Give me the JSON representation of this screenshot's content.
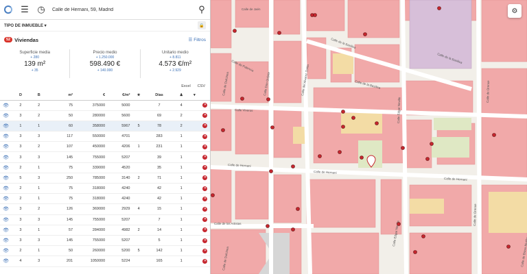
{
  "search": {
    "value": "Calle de Hernani, 59, Madrid"
  },
  "filter": {
    "property_type_label": "TIPO DE INMUEBLE"
  },
  "summary": {
    "count": "52",
    "label": "Viviendas",
    "filters_label": "Filtros"
  },
  "stats": [
    {
      "label": "Superficie media",
      "up": "+ 280",
      "value": "139 m²",
      "down": "+ 35"
    },
    {
      "label": "Precio medio",
      "up": "+ 1.250.000",
      "value": "598.490 €",
      "down": "+ 140.000"
    },
    {
      "label": "Unitario medio",
      "up": "+ 8.811",
      "value": "4.573 €/m²",
      "down": "+ 2.929"
    }
  ],
  "export": {
    "excel": "Excel",
    "csv": "CSV"
  },
  "table": {
    "headers": [
      "D",
      "B",
      "m²",
      "€",
      "€/m²",
      "Días"
    ],
    "rows": [
      [
        "2",
        "2",
        "75",
        "375000",
        "5000",
        "",
        "7",
        "4"
      ],
      [
        "3",
        "2",
        "50",
        "280000",
        "5600",
        "",
        "69",
        "2"
      ],
      [
        "1",
        "1",
        "60",
        "358000",
        "5967",
        "5",
        "78",
        "2"
      ],
      [
        "3",
        "3",
        "117",
        "550000",
        "4701",
        "",
        "283",
        "1"
      ],
      [
        "3",
        "2",
        "107",
        "450000",
        "4206",
        "1",
        "231",
        "1"
      ],
      [
        "3",
        "3",
        "145",
        "755000",
        "5207",
        "",
        "39",
        "1"
      ],
      [
        "2",
        "1",
        "75",
        "339000",
        "4520",
        "",
        "35",
        "1"
      ],
      [
        "5",
        "3",
        "250",
        "785000",
        "3140",
        "2",
        "71",
        "1"
      ],
      [
        "2",
        "1",
        "75",
        "318000",
        "4240",
        "",
        "42",
        "1"
      ],
      [
        "2",
        "1",
        "75",
        "318000",
        "4240",
        "",
        "42",
        "1"
      ],
      [
        "3",
        "2",
        "126",
        "369000",
        "2929",
        "4",
        "15",
        "1"
      ],
      [
        "3",
        "3",
        "145",
        "755000",
        "5207",
        "",
        "7",
        "1"
      ],
      [
        "3",
        "1",
        "57",
        "284000",
        "4982",
        "2",
        "14",
        "1"
      ],
      [
        "3",
        "3",
        "145",
        "755000",
        "5207",
        "",
        "5",
        "1"
      ],
      [
        "2",
        "1",
        "50",
        "260000",
        "5200",
        "5",
        "142",
        "1"
      ],
      [
        "4",
        "3",
        "201",
        "1050000",
        "5224",
        "",
        "165",
        "1"
      ]
    ]
  },
  "map": {
    "streets": [
      "Calle de Jaén",
      "Calle de la Basílica",
      "Calle de la Basílica",
      "Calle de la Basílica",
      "Calle de Palencia",
      "Calle de Dulcinea",
      "Calle Don Quijote",
      "Calle del Alvarez Zorita",
      "Calle Edgar Neville",
      "Calle de Orense",
      "Calle de Hernani",
      "Calle de Hernani",
      "Calle de Hernani",
      "Calle Viveros",
      "Calle de los Artistas",
      "Calle de Dulcinea",
      "Calle Edgar Neville",
      "Calle de Orense",
      "Calle de Bravo Murillo"
    ]
  },
  "colors": {
    "accent": "#3a6fb5",
    "danger": "#c6262e",
    "building": "#f1a9a9",
    "park": "#dfe8c4",
    "institution": "#d7bfd9"
  }
}
